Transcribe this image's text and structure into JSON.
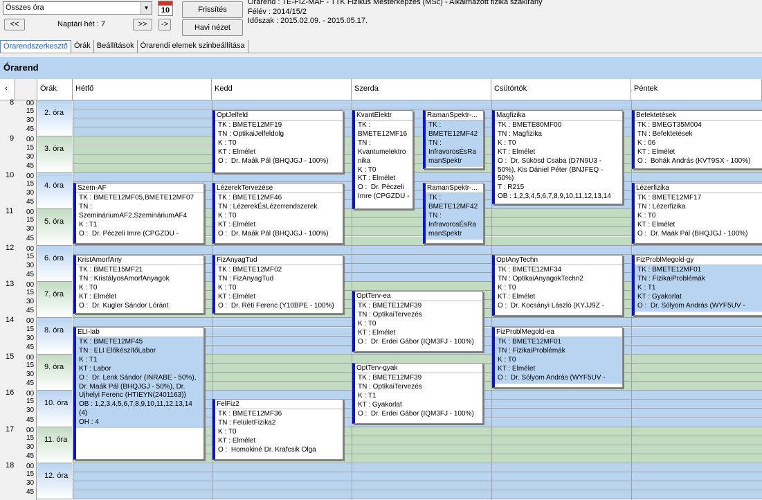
{
  "toolbar": {
    "combo_value": "Összes óra",
    "calendar_day": "10",
    "prev_label": "<<",
    "week_label": "Naptári hét : 7",
    "next_label": ">>",
    "jump_label": "->",
    "refresh_label": "Frissítés",
    "month_view_label": "Havi nézet"
  },
  "info": {
    "line1": "Órarend : TE-FIZ-MAF - TTK Fizikus Mesterképzés (MSc) - Alkalmazott fizika szakirány",
    "line2": "Félév : 2014/15/2",
    "line3": "Időszak : 2015.02.09. - 2015.05.17."
  },
  "tabs": [
    "Órarendszerkesztő",
    "Órák",
    "Beállítások",
    "Órarendi elemek szinbeállítása"
  ],
  "panel_title": "Órarend",
  "grid": {
    "corner": "‹",
    "hours_header": "Órák",
    "days": [
      "Hétfő",
      "Kedd",
      "Szerda",
      "Csütörtök",
      "Péntek"
    ],
    "hours": [
      "8",
      "9",
      "10",
      "11",
      "12",
      "13",
      "14",
      "15",
      "16",
      "17",
      "18"
    ],
    "minutes": [
      "00",
      "15",
      "30",
      "45"
    ],
    "periods": [
      "2. óra",
      "3. óra",
      "4. óra",
      "5. óra",
      "6. óra",
      "7. óra",
      "8. óra",
      "9. óra",
      "10. óra",
      "11. óra",
      "12. óra"
    ]
  },
  "colors": {
    "blue_row": "#b8d4f1",
    "green_row": "#c2dcc2",
    "accent": "#0a14c8"
  },
  "events": [
    {
      "day": "Kedd",
      "title": "OptJelfeld",
      "body": "TK : BMETE12MF19\nTN : OptikaiJelfeldolg\nK : T0\nKT : Elmélet\nO :  Dr. Maák Pál (BHQJGJ - 100%)",
      "blue": false
    },
    {
      "day": "Szerda",
      "title": "KvantElektr",
      "body": "TK :\nBMETE12MF16\nTN :\nKvantumelektro\nnika\nK : T0\nKT : Elmélet\nO :  Dr. Péczeli\nImre (CPGZDU -",
      "blue": false
    },
    {
      "day": "Szerda",
      "title": "RamanSpektr-...",
      "body": "TK :\nBMETE12MF42\nTN :\nInfravorosÉsRa\nmanSpektr",
      "blue": true
    },
    {
      "day": "Csütörtök",
      "title": "Magfizika",
      "body": "TK : BMETE80MF00\nTN : Magfizika\nK : T0\nKT : Elmélet\nO :  Dr. Sükösd Csaba (D7N9U3 -\n50%), Kis Dániel Péter (BNJFEQ -\n50%)\nT : R215\nOB : 1,2,3,4,5,6,7,8,9,10,11,12,13,14",
      "blue": false
    },
    {
      "day": "Péntek",
      "title": "Befektetések",
      "body": "TK : BMEGT35M004\nTN : Befektetések\nK : 06\nKT : Elmélet\nO :  Bohák András (KVT9SX - 100%)",
      "blue": false
    },
    {
      "day": "Hétfő",
      "title": "Szem-AF",
      "body": "TK : BMETE12MF05,BMETE12MF07\nTN :\nSzemináriumAF2,SzemináriumAF4\nK : T1\nO :  Dr. Péczeli Imre (CPGZDU -",
      "blue": false
    },
    {
      "day": "Kedd",
      "title": "LézerekTervezése",
      "body": "TK : BMETE12MF46\nTN : LézerekÉsLézerrendszerek\nK : T0\nKT : Elmélet\nO :  Dr. Maák Pál (BHQJGJ - 100%)",
      "blue": false
    },
    {
      "day": "Szerda",
      "title": "RamanSpektr-...",
      "body": "TK :\nBMETE12MF42\nTN :\nInfravorosÉsRa\nmanSpektr",
      "blue": true
    },
    {
      "day": "Péntek",
      "title": "Lézerfizika",
      "body": "TK : BMETE12MF17\nTN : Lézerfizika\nK : T0\nKT : Elmélet\nO :  Dr. Maák Pál (BHQJGJ - 100%)",
      "blue": false
    },
    {
      "day": "Hétfő",
      "title": "KristAmorfAny",
      "body": "TK : BMETE15MF21\nTN : KristályosAmorfAnyagok\nK : T0\nKT : Elmélet\nO :  Dr. Kugler Sándor Lóránt",
      "blue": false
    },
    {
      "day": "Kedd",
      "title": "FizAnyagTud",
      "body": "TK : BMETE12MF02\nTN : FizAnyagTud\nK : T0\nKT : Elmélet\nO :  Dr. Réti Ferenc (Y10BPE - 100%)",
      "blue": false
    },
    {
      "day": "Csütörtök",
      "title": "OptAnyTechn",
      "body": "TK : BMETE12MF34\nTN : OptikaiAnyagokTechn2\nK : T0\nKT : Elmélet\nO :  Dr. Kocsányi László (KYJJ9Z -",
      "blue": false
    },
    {
      "day": "Péntek",
      "title": "FizProblMegold-gy",
      "body": "TK : BMETE12MF01\nTN : FizikaiProblémák\nK : T1\nKT : Gyakorlat\nO :  Dr. Sólyom András (WYF5UV -",
      "blue": true
    },
    {
      "day": "Szerda",
      "title": "OptTerv-ea",
      "body": "TK : BMETE12MF39\nTN : OptikaiTervezés\nK : T0\nKT : Elmélet\nO :  Dr. Erdei Gábor (IQM3FJ - 100%)",
      "blue": false
    },
    {
      "day": "Hétfő",
      "title": "ELI-lab",
      "body": "TK : BMETE12MF45\nTN : ELI ElőkészítőLabor\nK : T1\nKT : Labor\nO :  Dr. Lenk Sándor (INRABE - 50%),\nDr. Maák Pál (BHQJGJ - 50%), Dr.\nUjhelyi Ferenc (HTIEYN(2401163))\nOB : 1,2,3,4,5,6,7,8,9,10,11,12,13,14\n(4)\nOH : 4",
      "blue": true
    },
    {
      "day": "Csütörtök",
      "title": "FizProblMegold-ea",
      "body": "TK : BMETE12MF01\nTN : FizikaiProblémák\nK : T0\nKT : Elmélet\nO :  Dr. Sólyom András (WYF5UV -",
      "blue": true
    },
    {
      "day": "Szerda",
      "title": "OptTerv-gyak",
      "body": "TK : BMETE12MF39\nTN : OptikaiTervezés\nK : T1\nKT : Gyakorlat\nO :  Dr. Erdei Gábor (IQM3FJ - 100%)",
      "blue": false
    },
    {
      "day": "Kedd",
      "title": "FelFiz2",
      "body": "TK : BMETE12MF36\nTN : FelületFizika2\nK : T0\nKT : Elmélet\nO :  Homokiné Dr. Krafcsik Olga",
      "blue": false
    }
  ]
}
